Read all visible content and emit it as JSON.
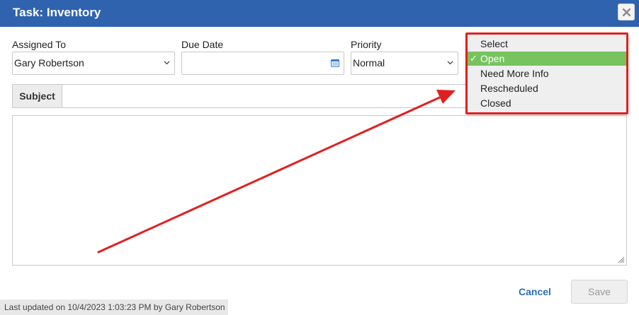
{
  "dialog": {
    "title": "Task: Inventory"
  },
  "fields": {
    "assigned_to_label": "Assigned To",
    "assigned_to_value": "Gary Robertson",
    "due_date_label": "Due Date",
    "due_date_value": "",
    "priority_label": "Priority",
    "priority_value": "Normal"
  },
  "subject": {
    "label": "Subject",
    "value": ""
  },
  "body": {
    "value": ""
  },
  "status_dropdown": {
    "options": [
      "Select",
      "Open",
      "Need More Info",
      "Rescheduled",
      "Closed"
    ],
    "selected": "Open",
    "check_mark": "✓"
  },
  "buttons": {
    "cancel_label": "Cancel",
    "save_label": "Save"
  },
  "footer": {
    "status_text": "Last updated on 10/4/2023 1:03:23 PM by Gary Robertson"
  },
  "colors": {
    "title_bar": "#2f63ae",
    "selected_option": "#77c35e",
    "annotation_red": "#e02020",
    "link_blue": "#2a6ebb",
    "calendar_icon": "#2f7bd6"
  },
  "icons": {
    "close": "close-icon",
    "calendar": "calendar-icon",
    "chevron": "chevron-down-icon",
    "resize": "resize-grip-icon"
  }
}
